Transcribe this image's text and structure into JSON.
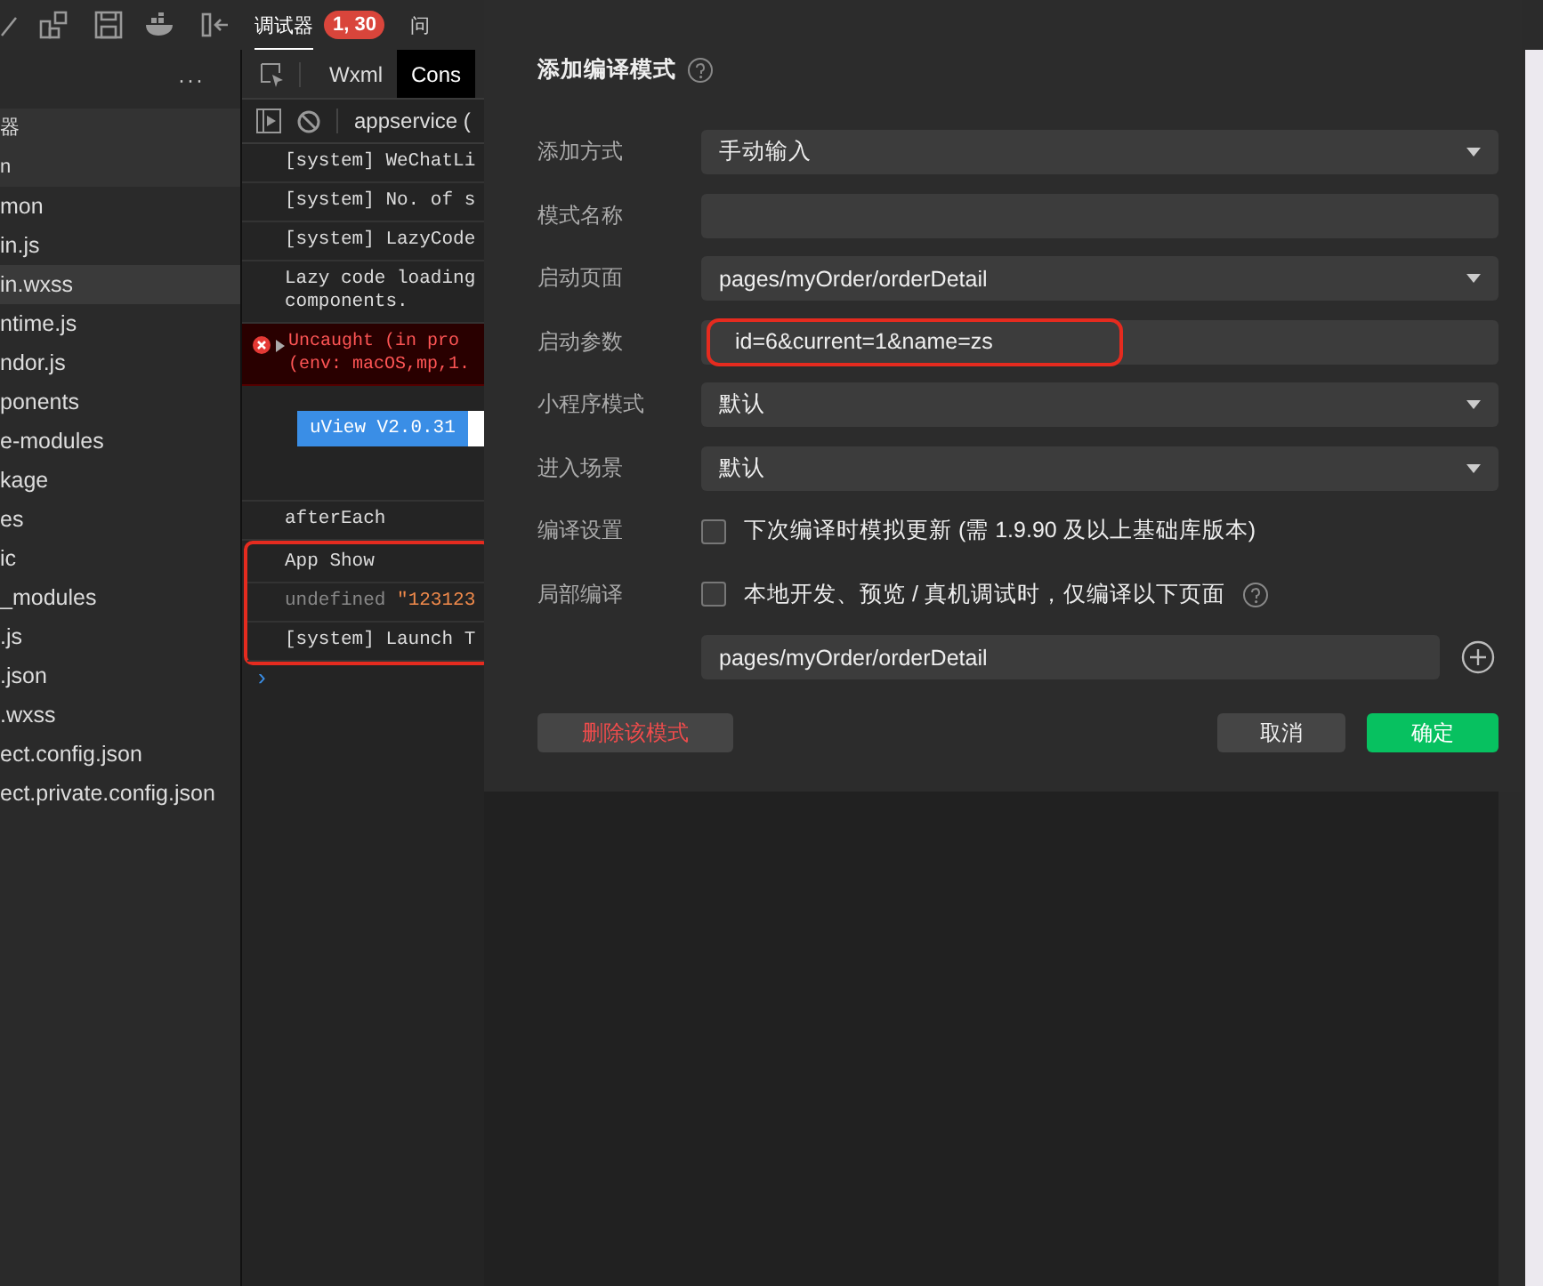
{
  "toolbar": {
    "tabs": [
      {
        "label": "调试器",
        "selected": true,
        "badge": "1, 30"
      },
      {
        "label": "问",
        "selected": false
      }
    ]
  },
  "file_tree": {
    "more": "···",
    "items": [
      {
        "name": "器",
        "kind": "header"
      },
      {
        "name": "n",
        "kind": "header"
      },
      {
        "name": "mon",
        "kind": "file",
        "selected": false
      },
      {
        "name": "in.js",
        "kind": "file",
        "selected": false
      },
      {
        "name": "in.wxss",
        "kind": "file",
        "selected": true
      },
      {
        "name": "ntime.js",
        "kind": "file",
        "selected": false
      },
      {
        "name": "ndor.js",
        "kind": "file",
        "selected": false
      },
      {
        "name": "ponents",
        "kind": "file",
        "selected": false
      },
      {
        "name": "e-modules",
        "kind": "file",
        "selected": false
      },
      {
        "name": "kage",
        "kind": "file",
        "selected": false
      },
      {
        "name": "es",
        "kind": "file",
        "selected": false
      },
      {
        "name": "ic",
        "kind": "file",
        "selected": false
      },
      {
        "name": "_modules",
        "kind": "file",
        "selected": false
      },
      {
        "name": ".js",
        "kind": "file",
        "selected": false
      },
      {
        "name": ".json",
        "kind": "file",
        "selected": false
      },
      {
        "name": ".wxss",
        "kind": "file",
        "selected": false
      },
      {
        "name": "ect.config.json",
        "kind": "file",
        "selected": false
      },
      {
        "name": "ect.private.config.json",
        "kind": "file",
        "selected": false
      }
    ]
  },
  "console": {
    "tabs": [
      {
        "label": "Wxml",
        "selected": false
      },
      {
        "label": "Cons",
        "selected": true
      }
    ],
    "context": "appservice (",
    "lines": [
      {
        "kind": "log",
        "text": "[system] WeChatLi",
        "highlighted": false
      },
      {
        "kind": "log",
        "text": "[system] No. of s",
        "highlighted": false
      },
      {
        "kind": "log",
        "text": "[system] LazyCode",
        "highlighted": false
      },
      {
        "kind": "log",
        "text": "Lazy code loading\ncomponents.",
        "highlighted": false
      },
      {
        "kind": "error",
        "text": "Uncaught (in pro\n(env: macOS,mp,1.",
        "highlighted": false
      },
      {
        "kind": "banner",
        "text": "uView V2.0.31",
        "highlighted": false
      },
      {
        "kind": "log",
        "text": "afterEach",
        "highlighted": false
      },
      {
        "kind": "log",
        "text": "App Show",
        "highlighted": true
      },
      {
        "kind": "value",
        "text": "undefined",
        "value": "\"123123",
        "highlighted": true
      },
      {
        "kind": "log",
        "text": "[system] Launch T",
        "highlighted": true
      }
    ],
    "prompt": "›"
  },
  "dialog": {
    "title": "添加编译模式",
    "fields": [
      {
        "kind": "select",
        "label": "添加方式",
        "value": "手动输入"
      },
      {
        "kind": "input",
        "label": "模式名称"
      },
      {
        "kind": "select",
        "label": "启动页面",
        "value": "pages/myOrder/orderDetail"
      },
      {
        "kind": "input",
        "label": "启动参数",
        "value": "id=6&current=1&name=zs",
        "highlighted": true
      },
      {
        "kind": "select",
        "label": "小程序模式",
        "value": "默认"
      },
      {
        "kind": "select",
        "label": "进入场景",
        "value": "默认"
      },
      {
        "kind": "checkbox",
        "label": "编译设置",
        "text": "下次编译时模拟更新 (需 1.9.90 及以上基础库版本)",
        "checked": false
      },
      {
        "kind": "checkbox",
        "label": "局部编译",
        "text": "本地开发、预览 / 真机调试时，仅编译以下页面",
        "checked": false,
        "help": true
      },
      {
        "kind": "path",
        "value": "pages/myOrder/orderDetail"
      }
    ],
    "buttons": [
      {
        "kind": "danger",
        "label": "删除该模式"
      },
      {
        "kind": "default",
        "label": "取消"
      },
      {
        "kind": "primary",
        "label": "确定"
      }
    ]
  }
}
